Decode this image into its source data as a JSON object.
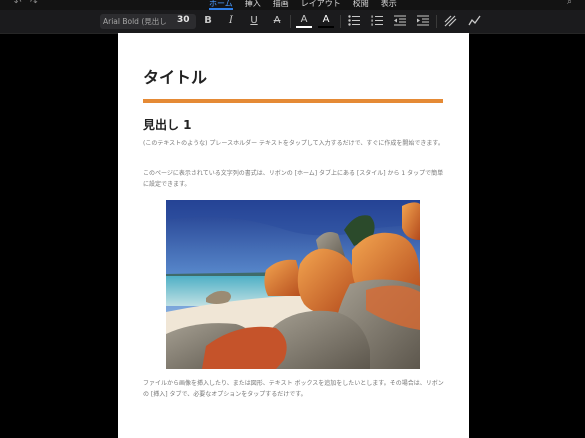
{
  "tabbar": {
    "tabs": [
      {
        "label": "ホーム",
        "active": true
      },
      {
        "label": "挿入",
        "active": false
      },
      {
        "label": "描画",
        "active": false
      },
      {
        "label": "レイアウト",
        "active": false
      },
      {
        "label": "校閲",
        "active": false
      },
      {
        "label": "表示",
        "active": false
      }
    ],
    "accent_color": "#2f7fe8"
  },
  "toolbar": {
    "font_name": "Arial Bold (見出し",
    "font_size": "30",
    "bold_label": "B",
    "italic_label": "I",
    "underline_label": "U",
    "strike_label": "A",
    "highlight_label": "A",
    "font_color_label": "A",
    "icons": [
      "bold-icon",
      "italic-icon",
      "underline-icon",
      "strikethrough-icon",
      "highlight-icon",
      "font-color-icon",
      "bullet-list-icon",
      "numbered-list-icon",
      "decrease-indent-icon",
      "increase-indent-icon",
      "styles-icon",
      "draw-pen-icon"
    ]
  },
  "document": {
    "title": "タイトル",
    "rule_color": "#e58a35",
    "heading1": "見出し 1",
    "paragraph1": "(このテキストのような) プレースホルダー テキストをタップして入力するだけで、すぐに作成を開始できます。",
    "paragraph2": "このページに表示されている文字列の書式は、リボンの [ホーム] タブ上にある [スタイル] から 1 タップで簡単に設定できます。",
    "paragraph3": "ファイルから画像を挿入したり、または図形、テキスト ボックスを追加をしたいとします。その場合は、リボンの [挿入] タブで、必要なオプションをタップするだけです。",
    "image": "beach-rocks-photo"
  }
}
